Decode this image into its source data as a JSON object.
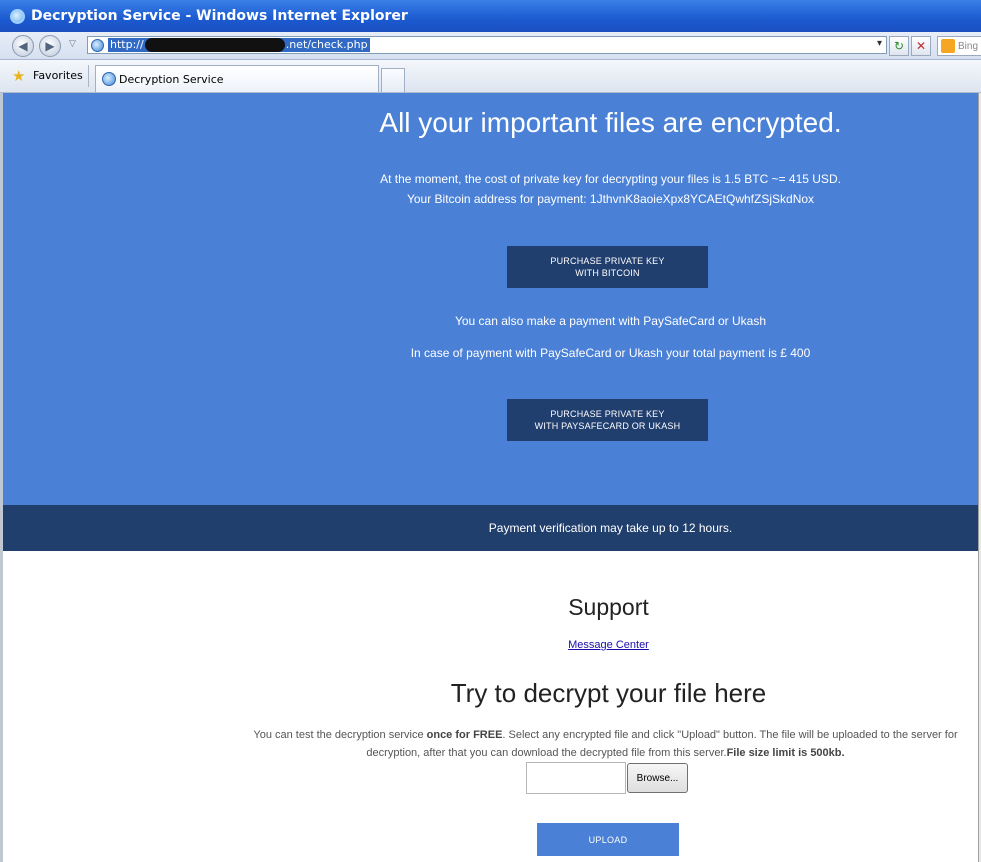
{
  "window": {
    "title": "Decryption Service - Windows Internet Explorer"
  },
  "toolbar": {
    "url_prefix": "http://",
    "url_suffix": ".net/check.php",
    "search_placeholder": "Bing"
  },
  "favorites_bar": {
    "favorites_label": "Favorites",
    "tab_label": "Decryption Service"
  },
  "hero": {
    "headline": "All your important files are encrypted.",
    "cost_text": "At the moment, the cost of private key for decrypting your files is 1.5 BTC ~= 415 USD.",
    "address_text": "Your Bitcoin address for payment: 1JthvnK8aoieXpx8YCAEtQwhfZSjSkdNox",
    "bitcoin_button_line1": "PURCHASE PRIVATE KEY",
    "bitcoin_button_line2": "WITH BITCOIN",
    "alt_payment_text": "You can also make a payment with PaySafeCard or Ukash",
    "alt_total_text": "In case of payment with PaySafeCard or Ukash your total payment is £ 400",
    "psc_button_line1": "PURCHASE PRIVATE KEY",
    "psc_button_line2": "WITH PAYSAFECARD OR UKASH"
  },
  "verification": {
    "text": "Payment verification may take up to 12 hours."
  },
  "support": {
    "title": "Support",
    "link_label": "Message Center"
  },
  "decrypt_test": {
    "title": "Try to decrypt your file here",
    "desc_part1": "You can test the decryption service ",
    "desc_bold1": "once for FREE",
    "desc_part2": ". Select any encrypted file and click \"Upload\" button. The file will be uploaded to the server for decryption, after that you can download the decrypted file from this server.",
    "desc_bold2": "File size limit is 500kb.",
    "browse_label": "Browse...",
    "upload_label": "UPLOAD"
  },
  "colors": {
    "hero_blue": "#4a80d6",
    "dark_band": "#213f6d",
    "button_dark": "#203e6e"
  }
}
